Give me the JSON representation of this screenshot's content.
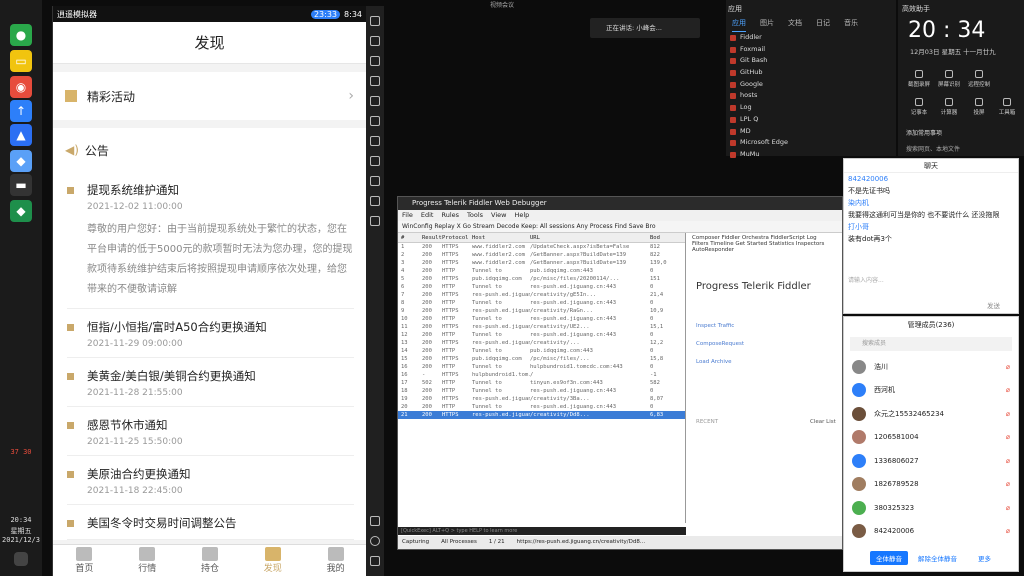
{
  "taskbar": {
    "indicators": "37 30",
    "time": "20:34",
    "weekday": "星期五",
    "date": "2021/12/3"
  },
  "emulator": {
    "title": "逍遥模拟器",
    "clock_badge": "23:33",
    "phone_time": "8:34"
  },
  "phone": {
    "page_title": "发现",
    "promo_label": "精彩活动",
    "announcement_label": "公告",
    "notices": [
      {
        "title": "提现系统维护通知",
        "date": "2021-12-02 11:00:00",
        "body": "尊敬的用户您好：由于当前提现系统处于繁忙的状态，您在平台申请的低于5000元的款项暂时无法为您办理，您的提现款项待系统维护结束后将按照提现申请顺序依次处理，给您带来的不便敬请谅解"
      },
      {
        "title": "恒指/小恒指/富时A50合约更换通知",
        "date": "2021-11-29 09:00:00"
      },
      {
        "title": "美黄金/美白银/美铜合约更换通知",
        "date": "2021-11-28 21:55:00"
      },
      {
        "title": "感恩节休市通知",
        "date": "2021-11-25 15:50:00"
      },
      {
        "title": "美原油合约更换通知",
        "date": "2021-11-18 22:45:00"
      },
      {
        "title": "美国冬令时交易时间调整公告",
        "date": ""
      }
    ],
    "nav": [
      "首页",
      "行情",
      "持仓",
      "发现",
      "我的"
    ]
  },
  "top": {
    "status": "视频会议",
    "speaker": "正在讲话: 小峰会..."
  },
  "fiddler": {
    "title": "Progress Telerik Fiddler Web Debugger",
    "menu": [
      "File",
      "Edit",
      "Rules",
      "Tools",
      "View",
      "Help"
    ],
    "toolbar": "WinConfig  Replay  X  Go  Stream  Decode  Keep: All sessions  Any Process  Find  Save  Bro",
    "columns": [
      "#",
      "Result",
      "Protocol",
      "Host",
      "URL",
      "Bod"
    ],
    "rows": [
      [
        "1",
        "200",
        "HTTPS",
        "www.fiddler2.com",
        "/UpdateCheck.aspx?isBeta=False",
        "812"
      ],
      [
        "2",
        "200",
        "HTTPS",
        "www.fiddler2.com",
        "/GetBanner.aspx?BuildDate=139",
        "822"
      ],
      [
        "3",
        "200",
        "HTTPS",
        "www.fiddler2.com",
        "/GetBanner.aspx?BuildDate=139",
        "139,0"
      ],
      [
        "4",
        "200",
        "HTTP",
        "Tunnel to",
        "pub.idqqimg.com:443",
        "0"
      ],
      [
        "5",
        "200",
        "HTTPS",
        "pub.idqqimg.com",
        "/pc/misc/files/20200114/...",
        "151"
      ],
      [
        "6",
        "200",
        "HTTP",
        "Tunnel to",
        "res-push.ed.jiguang.cn:443",
        "0"
      ],
      [
        "7",
        "200",
        "HTTPS",
        "res-push.ed.jiguan...",
        "/creativity/gE5In...",
        "21,4"
      ],
      [
        "8",
        "200",
        "HTTP",
        "Tunnel to",
        "res-push.ed.jiguang.cn:443",
        "0"
      ],
      [
        "9",
        "200",
        "HTTPS",
        "res-push.ed.jiguan...",
        "/creativity/RaGn...",
        "10,9"
      ],
      [
        "10",
        "200",
        "HTTP",
        "Tunnel to",
        "res-push.ed.jiguang.cn:443",
        "0"
      ],
      [
        "11",
        "200",
        "HTTPS",
        "res-push.ed.jiguan...",
        "/creativity/UE2...",
        "15,1"
      ],
      [
        "12",
        "200",
        "HTTP",
        "Tunnel to",
        "res-push.ed.jiguang.cn:443",
        "0"
      ],
      [
        "13",
        "200",
        "HTTPS",
        "res-push.ed.jiguan...",
        "/creativity/...",
        "12,2"
      ],
      [
        "14",
        "200",
        "HTTP",
        "Tunnel to",
        "pub.idqqimg.com:443",
        "0"
      ],
      [
        "15",
        "200",
        "HTTPS",
        "pub.idqqimg.com",
        "/pc/misc/files/...",
        "15,8"
      ],
      [
        "16",
        "200",
        "HTTP",
        "Tunnel to",
        "hulpbundroid1.tomcdc.com:443",
        "0"
      ],
      [
        "16",
        "-",
        "HTTPS",
        "hulpbundroid1.tom...",
        "/",
        "-1"
      ],
      [
        "17",
        "502",
        "HTTP",
        "Tunnel to",
        "tinyun.es9of3n.com:443",
        "582"
      ],
      [
        "18",
        "200",
        "HTTP",
        "Tunnel to",
        "res-push.ed.jiguang.cn:443",
        "0"
      ],
      [
        "19",
        "200",
        "HTTPS",
        "res-push.ed.jiguan...",
        "/creativity/3Ba...",
        "8,07"
      ],
      [
        "20",
        "200",
        "HTTP",
        "Tunnel to",
        "res-push.ed.jiguang.cn:443",
        "0"
      ],
      [
        "21",
        "200",
        "HTTPS",
        "res-push.ed.jiguan...",
        "/creativity/Dd8...",
        "6,83"
      ]
    ],
    "right_tabs": "Composer  Fiddler Orchestra  FiddlerScript  Log  Filters  Timeline  Get Started  Statistics  Inspectors  AutoResponder",
    "logo": "Progress Telerik Fiddler",
    "links": [
      "Inspect Traffic",
      "ComposeRequest",
      "Load Archive"
    ],
    "recent": "RECENT",
    "clear": "Clear List",
    "quickexec": "[QuickExec] ALT+Q > type HELP to learn more",
    "status": [
      "Capturing",
      "All Processes",
      "1 / 21",
      "https://res-push.ed.jiguang.cn/creativity/Dd8..."
    ]
  },
  "startmenu": {
    "title": "应用",
    "tabs": [
      "应用",
      "图片",
      "文档",
      "日记",
      "音乐",
      "设置"
    ],
    "items": [
      "Fiddler",
      "Foxmail",
      "Git Bash",
      "GitHub",
      "Google",
      "hosts",
      "Log",
      "LPL Q",
      "MD",
      "Microsoft Edge",
      "MuMu"
    ]
  },
  "clock": {
    "title": "高效助手",
    "time": "20 : 34",
    "date": "12月03日  星期五  十一月廿九",
    "actions": [
      "截图录屏",
      "屏幕识别",
      "远程控制",
      "记事本",
      "计算器",
      "投屏",
      "工具箱"
    ],
    "pin": "添加常用事项",
    "search": "搜索网页、本地文件"
  },
  "chat": {
    "title": "聊天",
    "lines": [
      "842420006",
      "不是先证书吗",
      "染内机",
      "我要得这通利可当是你的 也不要说什么 还没拖限",
      "打小哥",
      "装有dot再3个"
    ],
    "input_label": "发送",
    "placeholder": "请输入内容..."
  },
  "members": {
    "title": "管理成员(236)",
    "search_placeholder": "搜索成员",
    "list": [
      "浩川",
      "西河机",
      "众元之15532465234",
      "1206581004",
      "1336806027",
      "1826789528",
      "380325323",
      "842420006"
    ],
    "btn_mute_all": "全体静音",
    "btn_unmute": "解除全体静音",
    "btn_more": "更多"
  }
}
